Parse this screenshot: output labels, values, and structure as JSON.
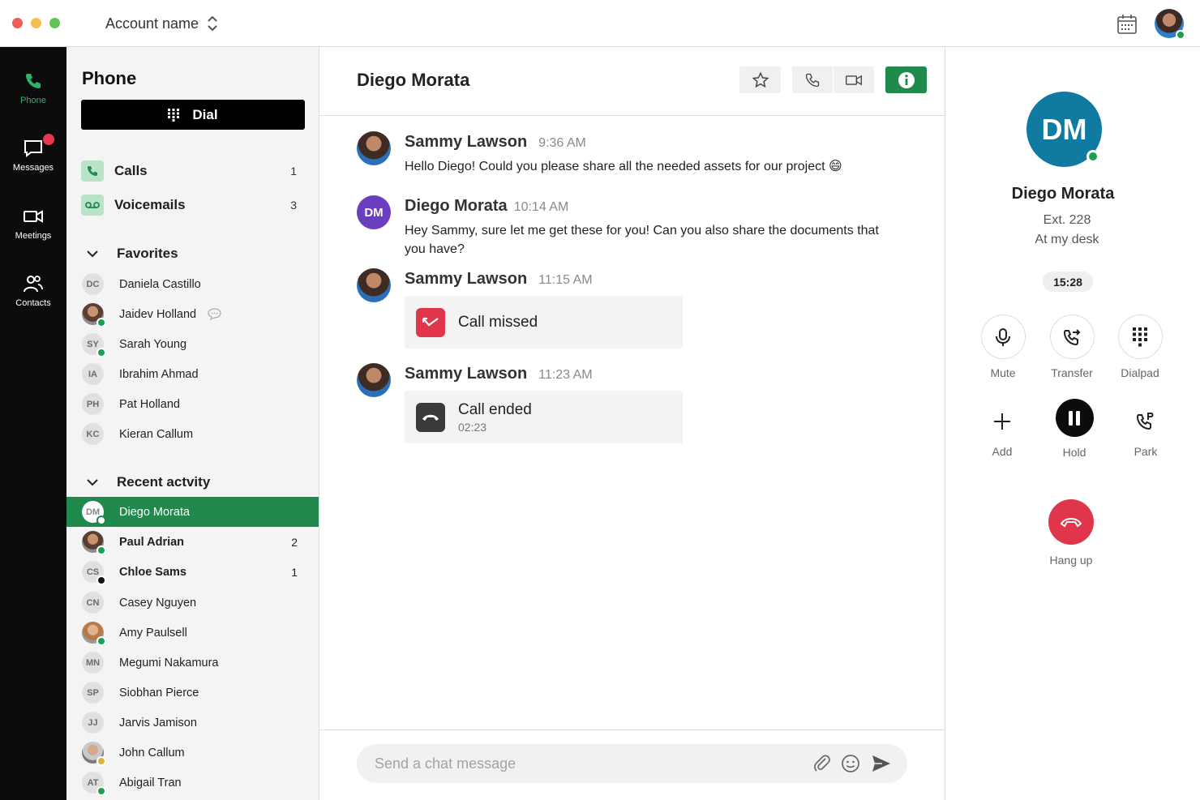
{
  "window": {
    "account_name": "Account name"
  },
  "rail": [
    {
      "label": "Phone"
    },
    {
      "label": "Messages"
    },
    {
      "label": "Meetings"
    },
    {
      "label": "Contacts"
    }
  ],
  "sidebar": {
    "title": "Phone",
    "dial_label": "Dial",
    "nav": [
      {
        "label": "Calls",
        "count": "1"
      },
      {
        "label": "Voicemails",
        "count": "3"
      }
    ],
    "favorites_title": "Favorites",
    "favorites": [
      {
        "initials": "DC",
        "name": "Daniela Castillo"
      },
      {
        "initials": "",
        "name": "Jaidev Holland"
      },
      {
        "initials": "SY",
        "name": "Sarah Young"
      },
      {
        "initials": "IA",
        "name": "Ibrahim Ahmad"
      },
      {
        "initials": "PH",
        "name": "Pat Holland"
      },
      {
        "initials": "KC",
        "name": "Kieran Callum"
      }
    ],
    "recent_title": "Recent actvity",
    "recent": [
      {
        "initials": "DM",
        "name": "Diego Morata",
        "count": ""
      },
      {
        "initials": "",
        "name": "Paul Adrian",
        "count": "2"
      },
      {
        "initials": "CS",
        "name": "Chloe Sams",
        "count": "1"
      },
      {
        "initials": "CN",
        "name": "Casey Nguyen",
        "count": ""
      },
      {
        "initials": "",
        "name": "Amy Paulsell",
        "count": ""
      },
      {
        "initials": "MN",
        "name": "Megumi Nakamura",
        "count": ""
      },
      {
        "initials": "SP",
        "name": "Siobhan Pierce",
        "count": ""
      },
      {
        "initials": "JJ",
        "name": "Jarvis Jamison",
        "count": ""
      },
      {
        "initials": "",
        "name": "John Callum",
        "count": ""
      },
      {
        "initials": "AT",
        "name": "Abigail Tran",
        "count": ""
      }
    ]
  },
  "chat": {
    "title": "Diego Morata",
    "messages": [
      {
        "sender": "Sammy Lawson",
        "time": "9:36 AM",
        "text": "Hello Diego! Could you please share all the needed assets for our project 😄"
      },
      {
        "sender": "Diego Morata",
        "initials": "DM",
        "time": "10:14 AM",
        "text": "Hey Sammy, sure let me get these for you! Can you also share the documents that you have?"
      },
      {
        "sender": "Sammy Lawson",
        "time": "11:15 AM",
        "card_title": "Call missed"
      },
      {
        "sender": "Sammy Lawson",
        "time": "11:23 AM",
        "card_title": "Call ended",
        "card_sub": "02:23"
      }
    ],
    "composer_placeholder": "Send a chat message"
  },
  "details": {
    "initials": "DM",
    "name": "Diego Morata",
    "ext": "Ext. 228",
    "status": "At my desk",
    "timer": "15:28",
    "controls": {
      "mute": "Mute",
      "transfer": "Transfer",
      "dialpad": "Dialpad",
      "add": "Add",
      "hold": "Hold",
      "park": "Park",
      "hangup": "Hang up"
    }
  },
  "colors": {
    "accent_green": "#1f8a4c",
    "rail_bg": "#0c0c0c",
    "missed_red": "#e0364b",
    "avatar_blue": "#117aa0",
    "avatar_purple": "#6a3ebf"
  }
}
